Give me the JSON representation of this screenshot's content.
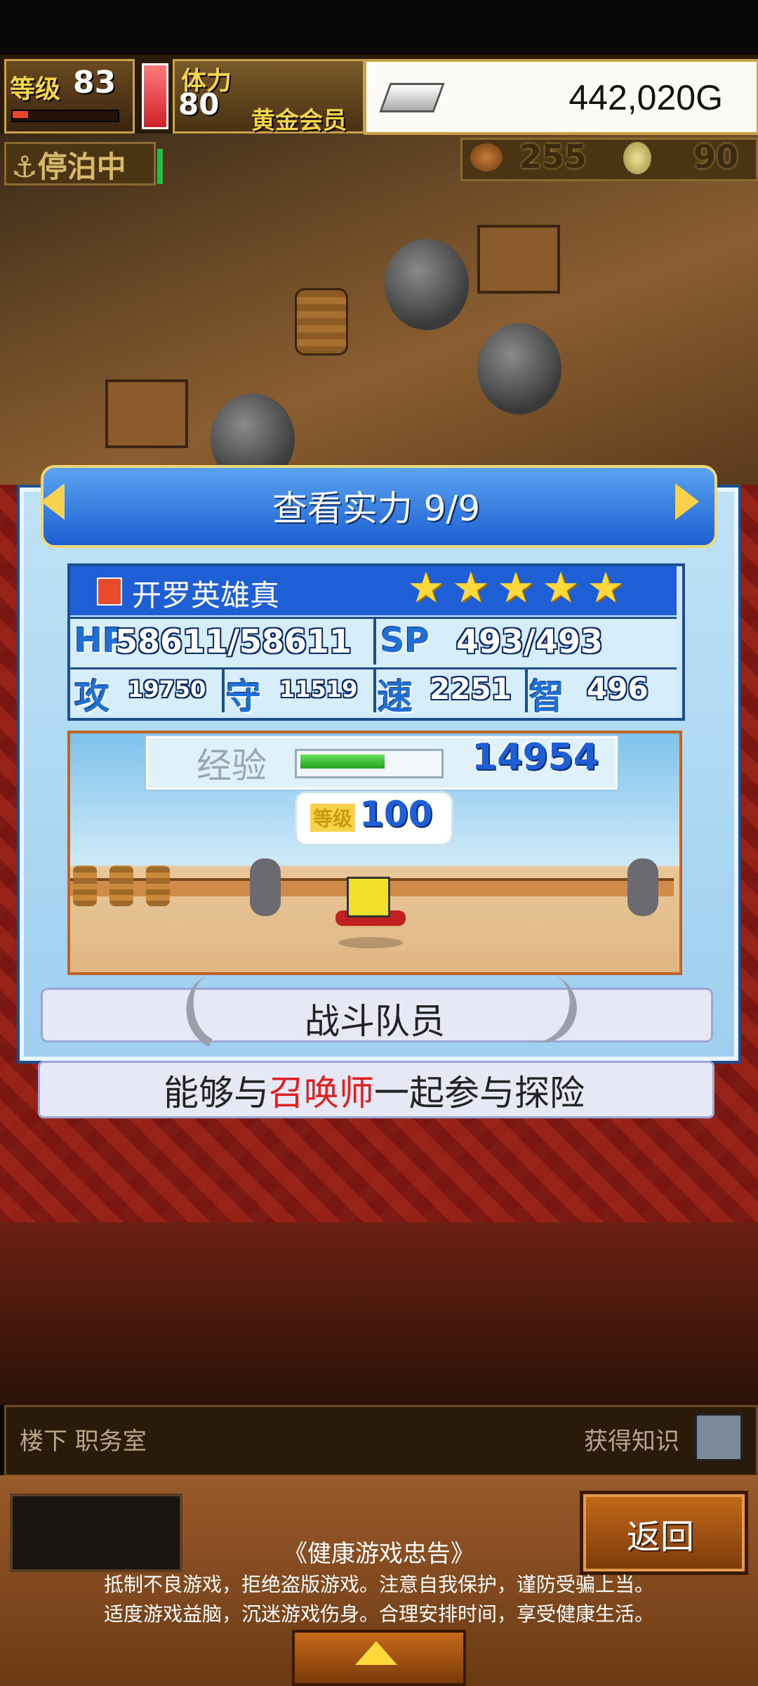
{
  "status": {
    "level_label": "等级",
    "level_value": "83",
    "level_progress": 0.15,
    "stamina_label": "体力",
    "stamina_value": "80",
    "membership": "黄金会员",
    "gold": "442,020G",
    "dock_status": "停泊中",
    "resource_1": "255",
    "resource_2": "90"
  },
  "dialog": {
    "title": "查看实力 9/9",
    "hero_name": "开罗英雄真",
    "stars": 5,
    "hp_label": "HP",
    "hp_value": "58611/58611",
    "sp_label": "SP",
    "sp_value": "493/493",
    "atk_label": "攻",
    "atk_value": "19750",
    "def_label": "守",
    "def_value": "11519",
    "spd_label": "速",
    "spd_value": "2251",
    "int_label": "智",
    "int_value": "496",
    "exp_label": "经验",
    "exp_value": "14954",
    "exp_progress": 0.63,
    "hero_level_label": "等级",
    "hero_level_value": "100",
    "role": "战斗队员",
    "desc_pre": "能够与",
    "desc_highlight": "召唤师",
    "desc_post": "一起参与探险"
  },
  "info_bar": {
    "location": "楼下 职务室",
    "knowledge": "获得知识"
  },
  "footer": {
    "back": "返回",
    "notice_title": "《健康游戏忠告》",
    "notice_line1": "抵制不良游戏，拒绝盗版游戏。注意自我保护，谨防受骗上当。",
    "notice_line2": "适度游戏益脑，沉迷游戏伤身。合理安排时间，享受健康生活。"
  },
  "colors": {
    "accent_blue": "#1f5fd6",
    "highlight_red": "#e02020",
    "star_gold": "#ffd83a"
  }
}
